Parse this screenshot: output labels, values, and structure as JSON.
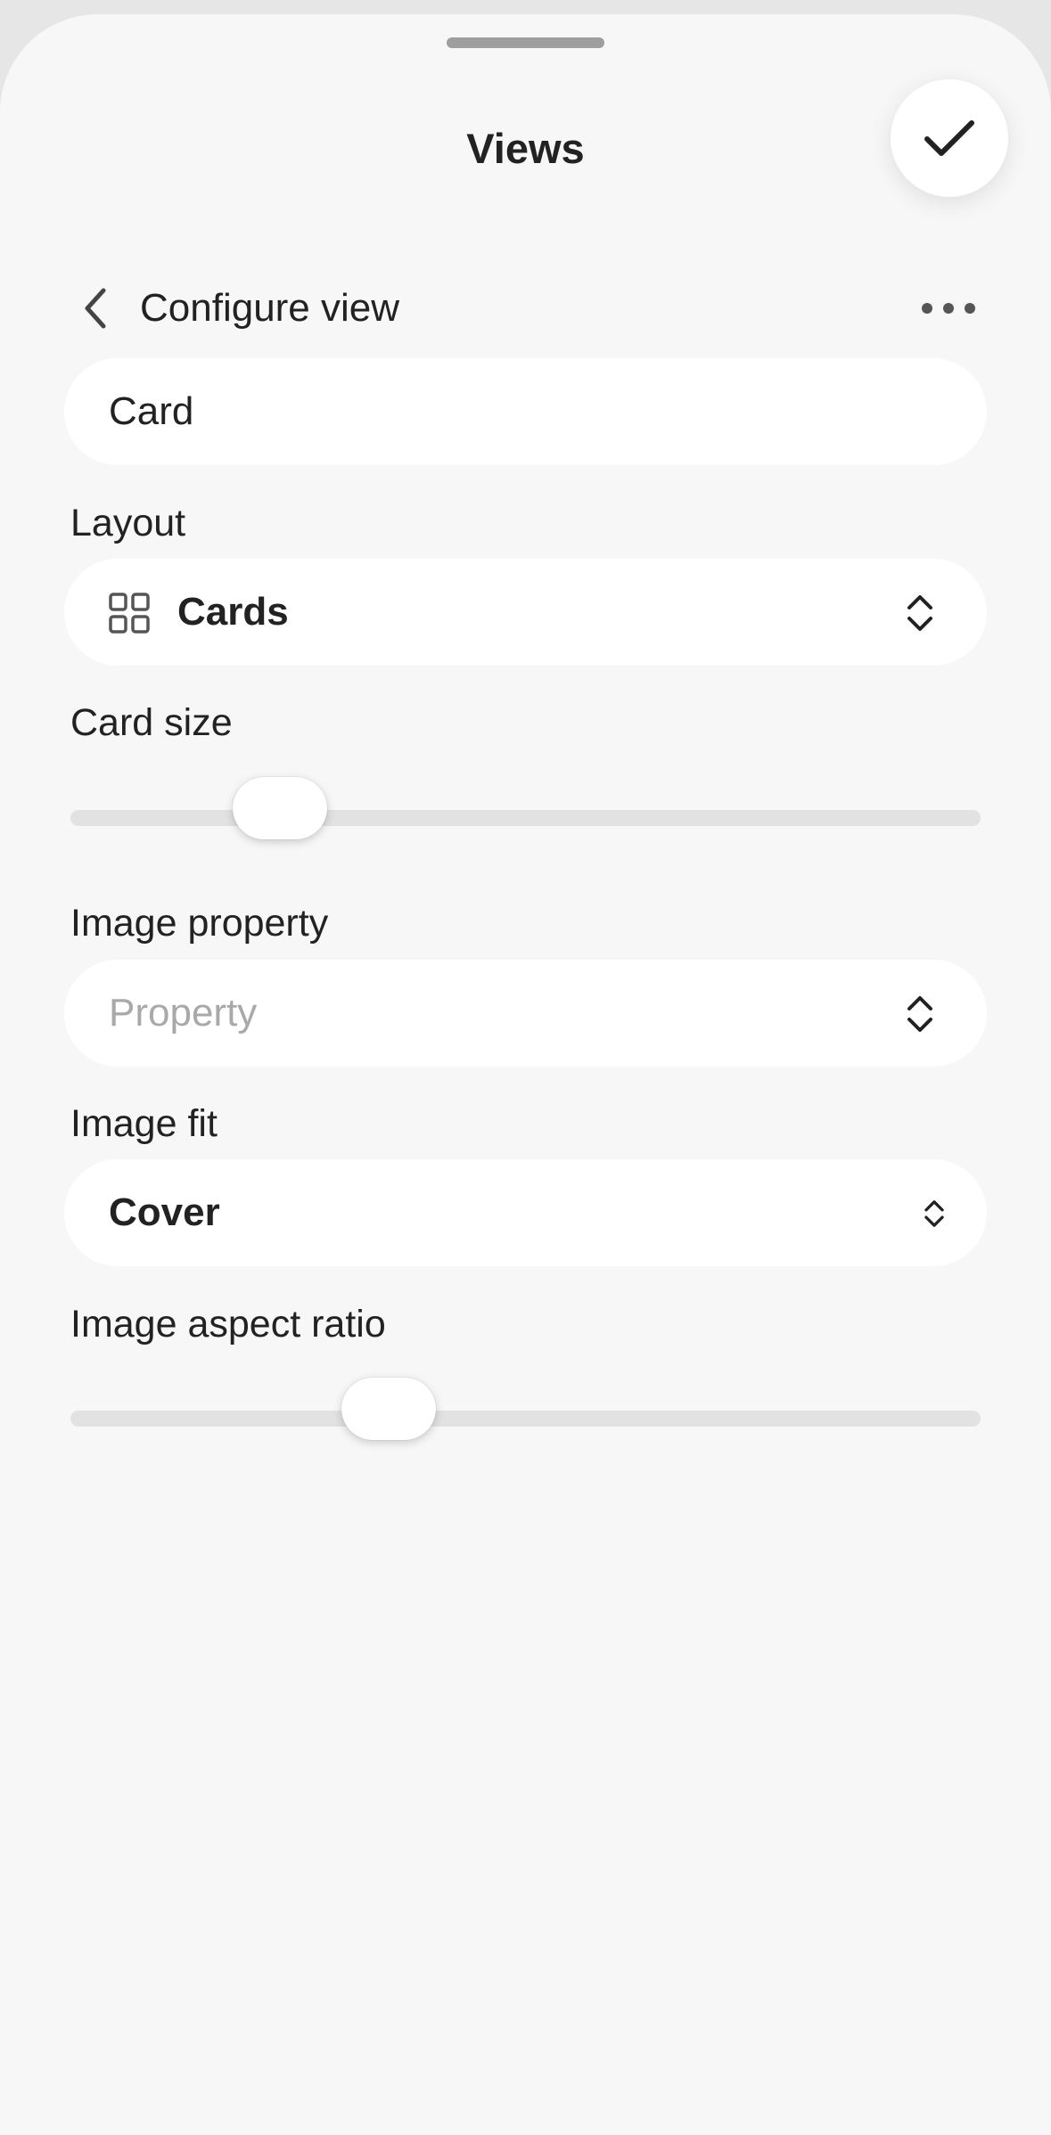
{
  "sheet": {
    "title": "Views"
  },
  "nav": {
    "title": "Configure view"
  },
  "name_field": {
    "value": "Card"
  },
  "layout": {
    "label": "Layout",
    "value": "Cards"
  },
  "card_size": {
    "label": "Card size",
    "level": 0.23
  },
  "image_property": {
    "label": "Image property",
    "placeholder": "Property"
  },
  "image_fit": {
    "label": "Image fit",
    "value": "Cover"
  },
  "image_aspect_ratio": {
    "label": "Image aspect ratio",
    "level": 0.35
  },
  "icons": {
    "confirm": "checkmark-icon",
    "back": "chevron-left-icon",
    "more": "more-horizontal-icon",
    "layout": "grid-icon",
    "selector": "chevron-up-down-icon"
  },
  "colors": {
    "background": "#f7f7f7",
    "surface": "#ffffff",
    "text": "#222222",
    "placeholder": "#a9a9a9",
    "track": "#e2e2e2"
  }
}
